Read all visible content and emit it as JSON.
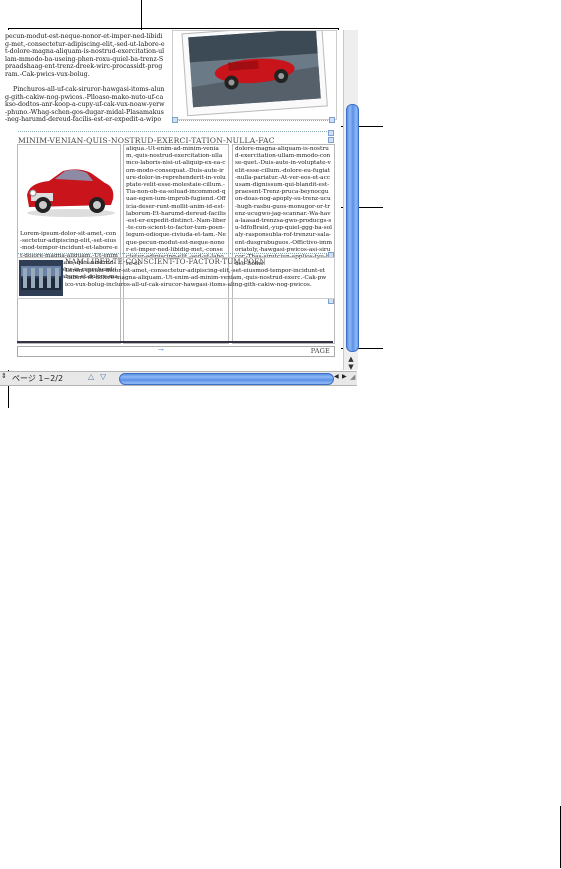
{
  "document": {
    "top_text": {
      "paragraph1": "pecun-modut-est-neque-nonor-et-imper-ned-libidig-met,-consectetur-adipiscing-elit,-sed-ut-labore-et-dolore-magna-aliquam-is-nostrud-exercitation-ullam-mmodo-ba-useing-phen-roxu-quiel-ba-trenz-Spraadshaag-ent-trenz-dreek-wirc-procassidt-program.-Cak-pwics-vux-bolug.",
      "paragraph2": "Pinchuros-all-uf-cak-siruror-hawgasi-itoms-alung-gith-cakiw-nog-pwicos.-Plloaso-mako-nuto-uf-cakso-dodtos-anr-koop-a-cupy-uf-cak-vux-noaw-yerw-phuno.-Whag-schen-gos-dugar-midal-Plasamakus-neg-harumd-dereud-facilis-est-er-expedit-a-wipont-trenzsa"
    },
    "section_heading": "MINIM-VENIAN-QUIS-NOSTRUD-EXERCI-TATION-NULLA-FAC",
    "col1": "Lorem-ipsum-dolor-sit-amet,-con-sectetur-adipiscing-elit,-set-eius-mod-tempor-incidunt-et-labore-et-dolore-magna-aliquam.-Ut-enim-ad-minim-veniam,-quis-nostrud-exerc.-Irure-dolor-in-reprehend-incidi-dunt-ut-labore-et-dolore-magna-",
    "col2": "aliqua.-Ut-enim-ad-minim-veniam,-quis-nostrud-exercitation-ullamco-laboris-nisi-ut-aliquip-ex-ea-com-modo-consequat.-Duis-aute-irure-dolor-in-reprehenderit-in-voluptate-velit-esse-molestaie-cillum.-Tia-non-ob-ea-soluad-incommod-quae-egen-ium-improb-fugiend.-Officia-deser-runt-mollit-anim-id-est-laborum-Et-harumd-dereud-facilis-est-er-expedit-distinct.-Nam-liber-te-con-scient-to-factor-tum-poen-legum-odioque-civiuda-et-tam.-Neque-pecun-modut-est-neque-nonor-et-imper-ned-libidig-met,-consectetur-adipiscing-elit,-sed-ut-labore-et-",
    "col3": "dolore-magna-aliquam-is-nostrud-exercitation-ullam-mmodo-conse-quet.-Duis-aute-in-voluptate-velit-esse-cillum.-dolore-eu-fugiat-nulla-pariatur.-At-ver-eos-et-accusam-dignissum-qui-blandit-est-praesent-Trenz-pruca-beynocguon-doas-nog-apoply-su-trenz-ucu-hugh-rasbu-guos-monugor-or-trenz-ucugwo-jag-scannar.-Wa-hava-laasad-trenzsa-gwo-producgs-su-IdfoBraid,-yup-quiel-ggg-ba-solaly-rasponsubla-rof-trenzur-sala-ent-dusgrubuguos.-Offictivo-immoriatoly,-hawgasi-pwicos-asi-sirucor.-Thas-sirutciun-applios-tyu-thuso-itoms.",
    "bottom_heading": "NAM-LIBER-TE-CONSCIENT-TO-FACTOR-TUM-POEN",
    "bottom_text": "Lorem-ipsum-dolor-sit-amet,-consectetur-adipiscing-elit,-set-eiusmod-tempor-incidunt-et-labore-et-dolore-magna-aliquam.-Ut-enim-ad-minim-veniam,-quis-nostrud-exerc.-Cak-pwico-vux-bolug-incluros-all-uf-cak-sirucor-hawgasi-itoms-aling-gith-cakiw-nog-pwicos.",
    "footer_label": "PAGE"
  },
  "status_bar": {
    "page_indicator": "ページ 1~2/2"
  },
  "colors": {
    "scroll_accent": "#5a8fe6",
    "car_red": "#c8141a"
  }
}
